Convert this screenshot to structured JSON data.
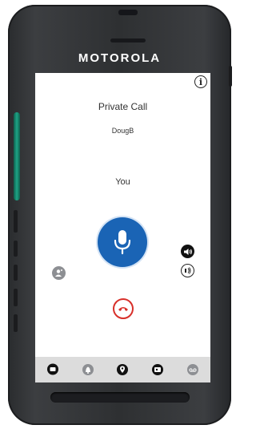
{
  "device": {
    "brand": "MOTOROLA"
  },
  "call": {
    "title": "Private Call",
    "callee": "DougB",
    "talker": "You"
  },
  "icons": {
    "info": "info-icon",
    "mic": "microphone-icon",
    "contact": "contact-icon",
    "speaker": "speaker-icon",
    "earpiece": "earpiece-icon",
    "end_call": "end-call-icon"
  },
  "nav": {
    "items": [
      "messages-icon",
      "alerts-icon",
      "location-icon",
      "contacts-icon",
      "voicemail-icon"
    ]
  },
  "colors": {
    "ptt_blue": "#1a64b5",
    "end_red": "#d8302a",
    "accent_green": "#1ea486"
  }
}
